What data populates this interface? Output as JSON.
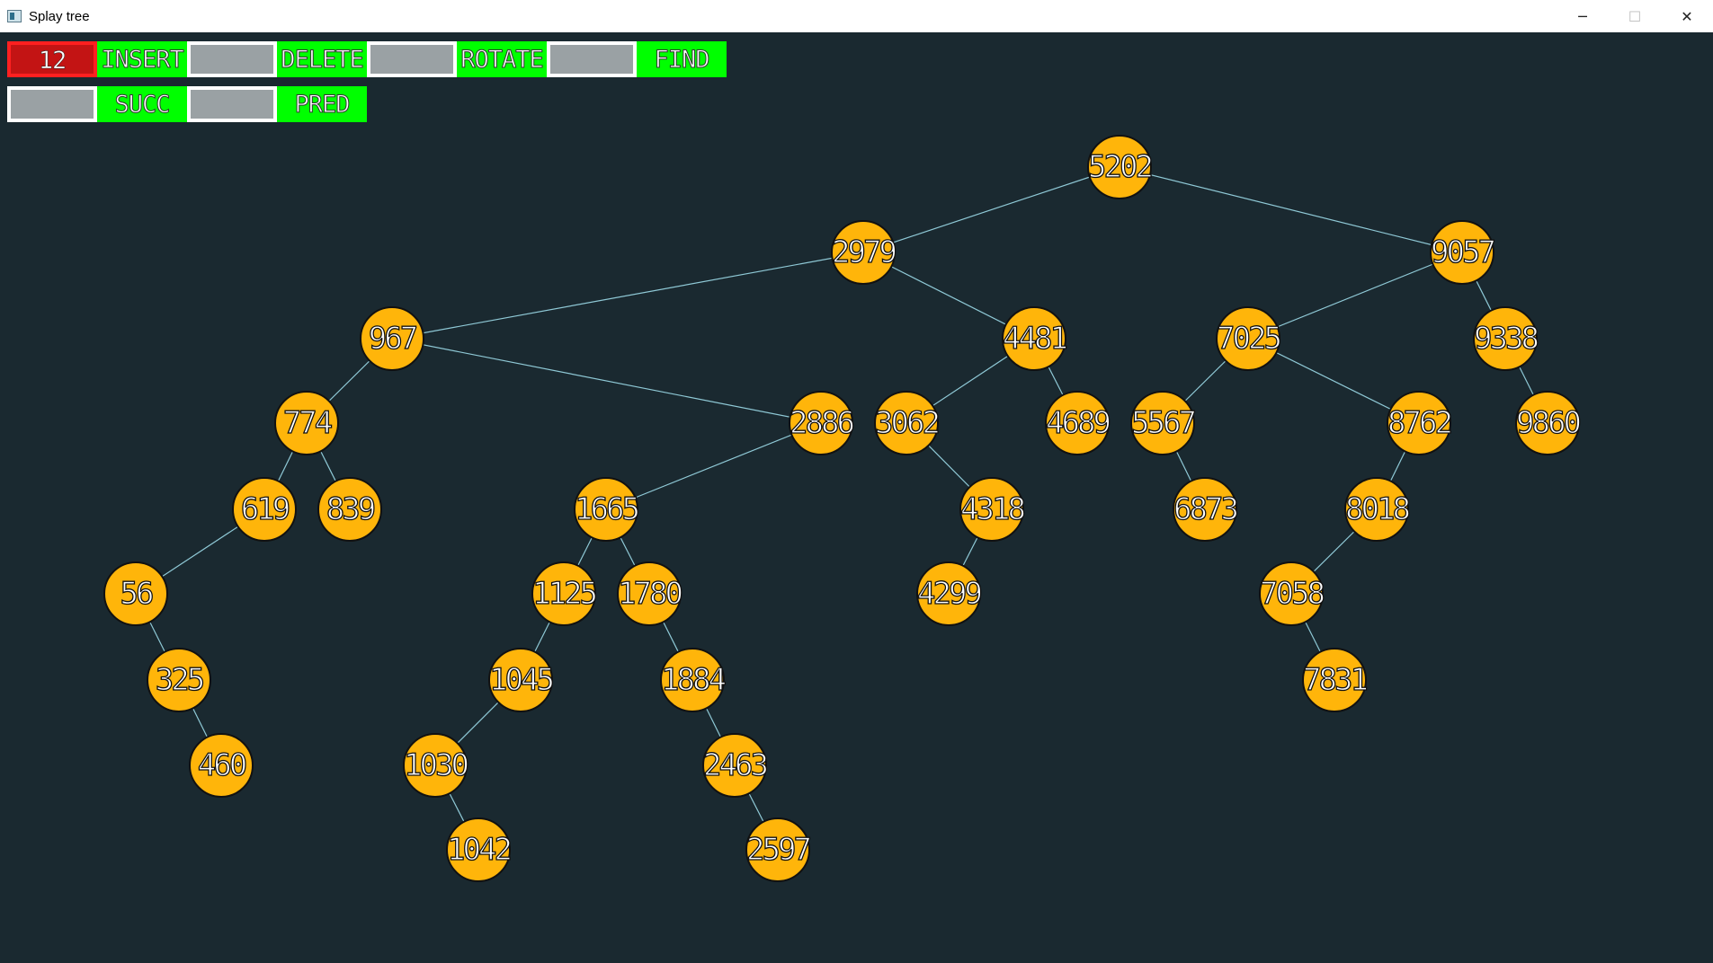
{
  "window": {
    "title": "Splay tree",
    "controls": {
      "minimize": "─",
      "maximize": "☐",
      "close": "✕"
    }
  },
  "toolbar": {
    "row1": [
      {
        "kind": "input",
        "value": "12",
        "state": "active"
      },
      {
        "kind": "button",
        "label": "INSERT"
      },
      {
        "kind": "input",
        "value": ""
      },
      {
        "kind": "button",
        "label": "DELETE"
      },
      {
        "kind": "input",
        "value": ""
      },
      {
        "kind": "button",
        "label": "ROTATE"
      },
      {
        "kind": "input",
        "value": ""
      },
      {
        "kind": "button",
        "label": "FIND"
      }
    ],
    "row2": [
      {
        "kind": "input",
        "value": ""
      },
      {
        "kind": "button",
        "label": "SUCC"
      },
      {
        "kind": "input",
        "value": ""
      },
      {
        "kind": "button",
        "label": "PRED"
      }
    ]
  },
  "colors": {
    "background": "#1a2930",
    "node_fill": "#ffb50a",
    "node_stroke": "#111111",
    "edge": "#8fc9d6",
    "button": "#00ff00",
    "active_input": "#c31414"
  },
  "tree": {
    "root": "5202",
    "edges": [
      [
        "5202",
        "2979"
      ],
      [
        "5202",
        "9057"
      ],
      [
        "2979",
        "967"
      ],
      [
        "2979",
        "4481"
      ],
      [
        "967",
        "774"
      ],
      [
        "967",
        "2886"
      ],
      [
        "774",
        "619"
      ],
      [
        "774",
        "839"
      ],
      [
        "619",
        "56"
      ],
      [
        "56",
        "325"
      ],
      [
        "325",
        "460"
      ],
      [
        "2886",
        "1665"
      ],
      [
        "1665",
        "1125"
      ],
      [
        "1665",
        "1780"
      ],
      [
        "1125",
        "1045"
      ],
      [
        "1045",
        "1030"
      ],
      [
        "1030",
        "1042"
      ],
      [
        "1780",
        "1884"
      ],
      [
        "1884",
        "2463"
      ],
      [
        "2463",
        "2597"
      ],
      [
        "4481",
        "3062"
      ],
      [
        "4481",
        "4689"
      ],
      [
        "3062",
        "4318"
      ],
      [
        "4318",
        "4299"
      ],
      [
        "9057",
        "7025"
      ],
      [
        "9057",
        "9338"
      ],
      [
        "7025",
        "5567"
      ],
      [
        "7025",
        "8762"
      ],
      [
        "5567",
        "6873"
      ],
      [
        "8762",
        "8018"
      ],
      [
        "8018",
        "7058"
      ],
      [
        "7058",
        "7831"
      ],
      [
        "9338",
        "9860"
      ]
    ],
    "nodes": [
      "5202",
      "2979",
      "9057",
      "967",
      "4481",
      "7025",
      "9338",
      "774",
      "2886",
      "3062",
      "4689",
      "5567",
      "8762",
      "9860",
      "619",
      "839",
      "1665",
      "4318",
      "6873",
      "8018",
      "56",
      "1125",
      "1780",
      "4299",
      "7058",
      "325",
      "1045",
      "1884",
      "7831",
      "460",
      "1030",
      "2463",
      "1042",
      "2597"
    ]
  }
}
